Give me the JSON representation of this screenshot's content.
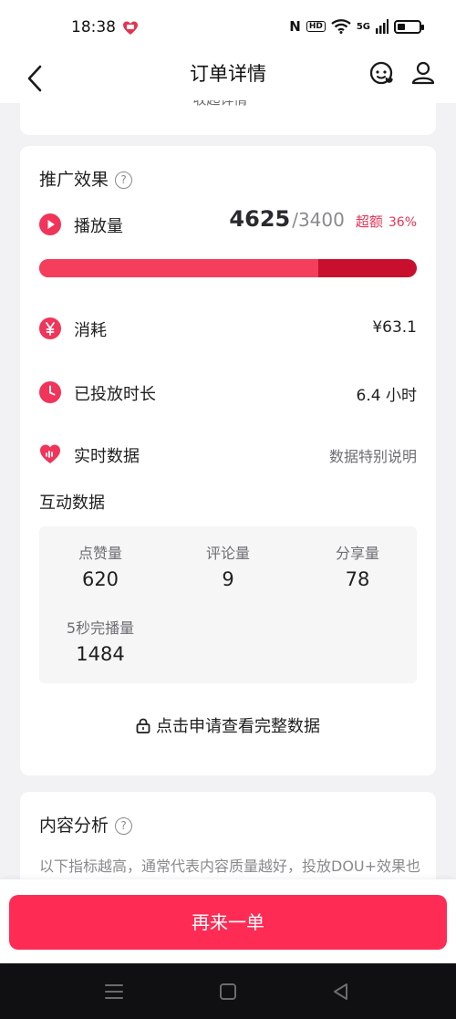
{
  "status_bar": {
    "time": "18:38",
    "nfc_label": "N",
    "hd_label": "HD",
    "network_label": "5G",
    "battery_level": 0.35
  },
  "nav": {
    "title": "订单详情"
  },
  "top_card": {
    "collapse_label": "收起详情 ^"
  },
  "promotion": {
    "title": "推广效果",
    "help_glyph": "?",
    "views": {
      "label": "播放量",
      "current": "4625",
      "target": "/3400",
      "over_label": "超额",
      "over_pct": "36%",
      "progress_fraction": 0.74
    },
    "cost": {
      "label": "消耗",
      "value": "¥63.1"
    },
    "duration": {
      "label": "已投放时长",
      "value": "6.4 小时"
    },
    "realtime": {
      "label": "实时数据",
      "link": "数据特别说明"
    },
    "interaction_title": "互动数据",
    "stats": [
      {
        "label": "点赞量",
        "value": "620"
      },
      {
        "label": "评论量",
        "value": "9"
      },
      {
        "label": "分享量",
        "value": "78"
      },
      {
        "label": "5秒完播量",
        "value": "1484"
      }
    ],
    "unlock_label": "点击申请查看完整数据"
  },
  "analysis": {
    "title": "内容分析",
    "help_glyph": "?",
    "description": "以下指标越高，通常代表内容质量越好，投放DOU+效果也越好"
  },
  "action": {
    "reorder_label": "再来一单"
  },
  "colors": {
    "accent": "#fe2c55",
    "progress_fill": "#f43e5c",
    "progress_over": "#c80f2e",
    "highlight_text": "#e93356"
  },
  "icons": {
    "back": "chevron-left-icon",
    "service": "customer-service-icon",
    "profile": "user-icon",
    "views": "play-icon",
    "cost": "yen-icon",
    "duration": "clock-icon",
    "realtime": "heart-pulse-icon",
    "lock": "lock-icon"
  }
}
